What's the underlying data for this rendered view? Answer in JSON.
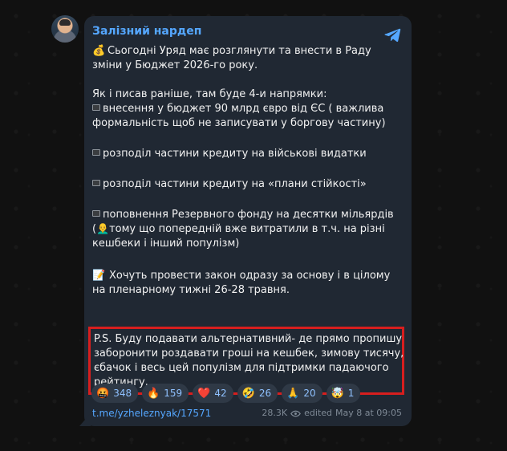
{
  "post": {
    "channel_name": "Залізний нардеп",
    "line1": "Сьогодні Уряд має розглянути та внести в Раду",
    "line2": "зміни у Бюджет 2026-го року.",
    "line3": "Як і писав раніше, там буде 4-и напрямки:",
    "line4": "внесення у бюджет 90 млрд євро від ЄС ( важлива",
    "line5": "формальність щоб не записувати у боргову частину)",
    "line6": "розподіл частини кредиту на військові видатки",
    "line7": "розподіл частини кредиту на «плани стійкості»",
    "line8": "поповнення Резервного фонду на десятки мільярдів",
    "line9": "(",
    "line9b": "тому що попередній вже витратили в т.ч. на різні",
    "line10": "кешбеки і інший популізм)",
    "line11": "Хочуть провести закон одразу за основу і в цілому",
    "line12": "на пленарному тижні 26-28 травня.",
    "ps1": "P.S. Буду подавати альтернативний- де прямо пропишу",
    "ps2": "заборонити роздавати гроші на кешбек, зимову тисячу,",
    "ps3": "єбачок і весь цей популізм для підтримки падаючого",
    "ps4": "рейтингу.",
    "emojis": {
      "money": "💰",
      "person": "👨‍🦲",
      "calendar": "📝"
    }
  },
  "reactions": [
    {
      "emoji": "🤬",
      "count": "348"
    },
    {
      "emoji": "🔥",
      "count": "159"
    },
    {
      "emoji": "❤️",
      "count": "42"
    },
    {
      "emoji": "🤣",
      "count": "26"
    },
    {
      "emoji": "🙏",
      "count": "20"
    },
    {
      "emoji": "🤯",
      "count": "1"
    }
  ],
  "footer": {
    "link": "t.me/yzheleznyak/17571",
    "views": "28.3K",
    "edited": "edited",
    "date": "May 8 at 09:05"
  },
  "colors": {
    "background": "#111111",
    "bubble": "#202833",
    "accent": "#55a7ff",
    "highlight_border": "#d71e1e"
  },
  "icons": {
    "telegram": "telegram-icon",
    "views": "eye-icon"
  }
}
